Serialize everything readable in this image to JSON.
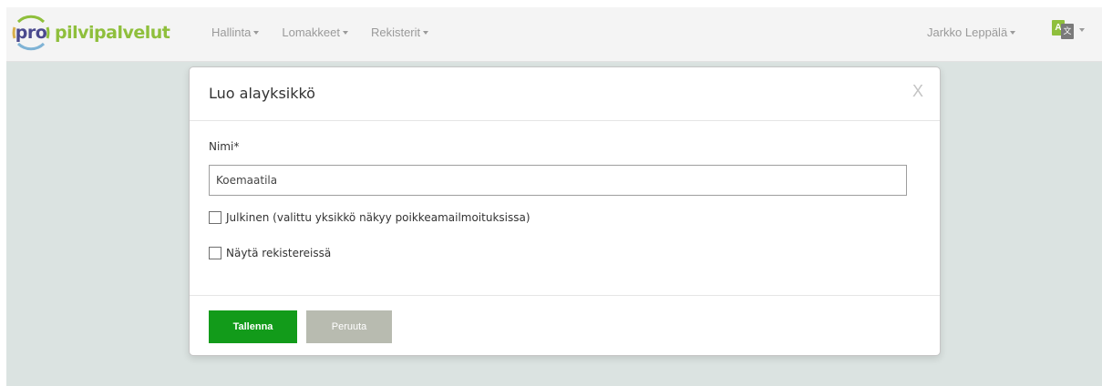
{
  "brand": {
    "logo_prefix": "pro",
    "logo_name": "pilvipalvelut"
  },
  "nav": {
    "items": [
      {
        "label": "Hallinta"
      },
      {
        "label": "Lomakkeet"
      },
      {
        "label": "Rekisterit"
      }
    ],
    "user_label": "Jarkko Leppälä",
    "language_icon": "translate-icon"
  },
  "modal": {
    "title": "Luo alayksikkö",
    "close_label": "X",
    "name_label": "Nimi*",
    "name_value": "Koemaatila",
    "checkboxes": [
      {
        "label": "Julkinen (valittu yksikkö näkyy poikkeamailmoituksissa)",
        "checked": false
      },
      {
        "label": "Näytä rekistereissä",
        "checked": false
      }
    ],
    "save_label": "Tallenna",
    "cancel_label": "Peruuta"
  },
  "colors": {
    "brand_green": "#8fbf3c",
    "brand_purple": "#4b4a8e",
    "save_button": "#129b1a",
    "cancel_button": "#b8bbb0",
    "backdrop": "#dbe3e1"
  }
}
